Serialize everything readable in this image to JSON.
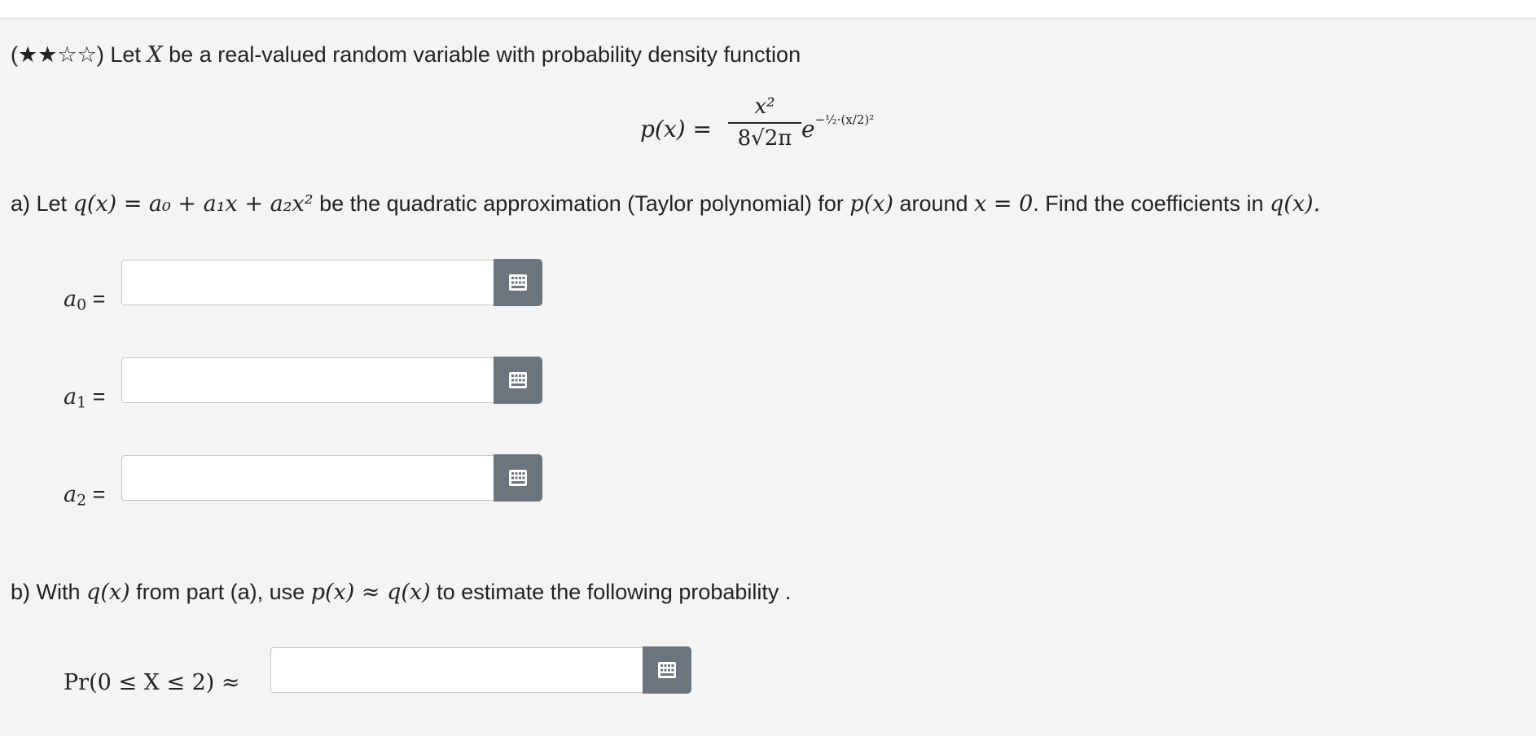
{
  "question": {
    "difficulty_stars": "★★☆☆",
    "intro_before_var": "Let",
    "variable": "X",
    "intro_after_var": "be a real-valued random variable with probability density function"
  },
  "formula": {
    "lhs": "p(x) =",
    "numerator": "x²",
    "denominator": "8√2π",
    "exp_base": "e",
    "exponent": "−½·(x/2)²"
  },
  "part_a": {
    "prefix": "a) Let",
    "q_expr": "q(x) = a₀ + a₁x + a₂x²",
    "middle": "be the quadratic approximation (Taylor polynomial) for",
    "p_expr": "p(x)",
    "around": "around",
    "point": "x = 0",
    "suffix": ". Find the coefficients in",
    "q_end": "q(x)."
  },
  "fields": [
    {
      "label_var": "a",
      "label_sub": "0",
      "label_eq": "=",
      "value": "",
      "placeholder": ""
    },
    {
      "label_var": "a",
      "label_sub": "1",
      "label_eq": "=",
      "value": "",
      "placeholder": ""
    },
    {
      "label_var": "a",
      "label_sub": "2",
      "label_eq": "=",
      "value": "",
      "placeholder": ""
    }
  ],
  "part_b": {
    "prefix": "b) With",
    "q_expr": "q(x)",
    "middle": "from part (a), use",
    "approx": "p(x) ≈ q(x)",
    "suffix": "to estimate the following probability ."
  },
  "prob_field": {
    "label": "Pr(0 ≤ X ≤ 2) ≈",
    "value": "",
    "placeholder": ""
  },
  "icons": {
    "keypad": "keypad-grid-icon"
  },
  "colors": {
    "background": "#f4f4f4",
    "button": "#6c757d",
    "input_border": "#c6c6c6"
  }
}
